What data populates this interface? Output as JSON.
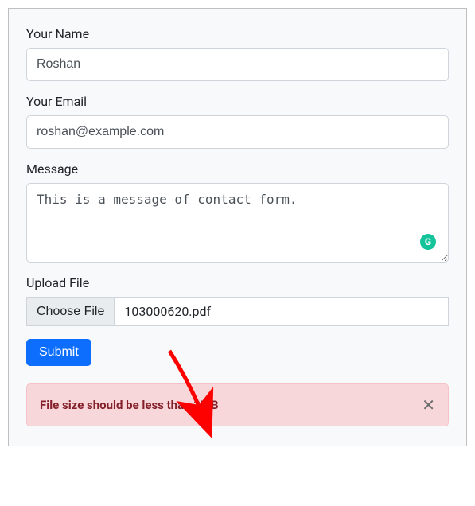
{
  "form": {
    "name": {
      "label": "Your Name",
      "value": "Roshan"
    },
    "email": {
      "label": "Your Email",
      "value": "roshan@example.com"
    },
    "message": {
      "label": "Message",
      "value": "This is a message of contact form."
    },
    "upload": {
      "label": "Upload File",
      "choose_btn": "Choose File",
      "file_name": "103000620.pdf"
    },
    "submit_label": "Submit"
  },
  "alert": {
    "text": "File size should be less than 2MB",
    "close_glyph": "✕"
  },
  "badge_letter": "G"
}
